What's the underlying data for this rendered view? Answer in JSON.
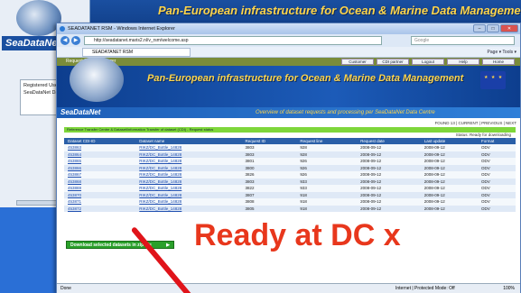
{
  "background_window": {
    "banner_title": "Pan-European infrastructure for Ocean & Marine Data Management",
    "logo_text": "SeaDataNet",
    "box_text": "Registered Users ca SeaDataNet Data Ce"
  },
  "ie": {
    "title": "SEADATANET RSM - Windows Internet Explorer",
    "url": "http://seadatanet.maris2.nl/v_rsm/welcome.asp",
    "search_placeholder": "Google",
    "tab_label": "SEADATANET RSM",
    "tools": "Page ▾  Tools ▾",
    "controls": {
      "min": "–",
      "max": "□",
      "close": "✕"
    }
  },
  "page": {
    "menu_left": "Request Status Manager",
    "menu_buttons": [
      "Customer",
      "CDI partner",
      "Logout",
      "Help",
      "Home"
    ],
    "banner_title": "Pan-European infrastructure for Ocean & Marine Data Management",
    "logo_text": "SeaDataNet",
    "overview": "Overview of dataset requests and processing per SeaDataNet Data Centre",
    "pager": "FOUND 13 | CURRENT | PREVIOUS | NEXT",
    "info_bar": "Reference Transfer Centre & Dataset/information   Transfer of dataset (CDI) - Request status",
    "status_line": "Status: Ready for downloading",
    "table": {
      "headers": [
        "Dataset CDI-ID",
        "Dataset name",
        "Request ID",
        "Request line",
        "Request date",
        "Last update",
        "Format"
      ],
      "rows": [
        [
          "453863",
          "RIKZ/DC_Bottle_14828",
          "3803",
          "928",
          "2008-09-12",
          "2008-09-12",
          "ODV"
        ],
        [
          "453864",
          "RIKZ/DC_Bottle_14828",
          "3803",
          "928",
          "2008-09-12",
          "2008-09-12",
          "ODV"
        ],
        [
          "453865",
          "RIKZ/DC_Bottle_14828",
          "3801",
          "926",
          "2008-09-12",
          "2008-09-12",
          "ODV"
        ],
        [
          "453866",
          "RIKZ/DC_Bottle_14828",
          "3800",
          "926",
          "2008-09-12",
          "2008-09-12",
          "ODV"
        ],
        [
          "453867",
          "RIKZ/DC_Bottle_14828",
          "3826",
          "926",
          "2008-09-12",
          "2008-09-12",
          "ODV"
        ],
        [
          "453868",
          "RIKZ/DC_Bottle_14828",
          "3803",
          "933",
          "2008-09-12",
          "2008-09-12",
          "ODV"
        ],
        [
          "453869",
          "RIKZ/DC_Bottle_14828",
          "3822",
          "933",
          "2008-09-12",
          "2008-09-12",
          "ODV"
        ],
        [
          "453870",
          "RIKZ/DC_Bottle_14828",
          "3807",
          "918",
          "2008-09-12",
          "2008-09-12",
          "ODV"
        ],
        [
          "453871",
          "RIKZ/DC_Bottle_14828",
          "3808",
          "918",
          "2008-09-12",
          "2008-09-12",
          "ODV"
        ],
        [
          "453872",
          "RIKZ/DC_Bottle_14828",
          "3805",
          "918",
          "2008-09-12",
          "2008-09-12",
          "ODV"
        ]
      ]
    },
    "download_label": "Download selected datasets in zip file"
  },
  "overlay": {
    "ready_text": "Ready at DC x"
  },
  "statusbar": {
    "done": "Done",
    "zone": "Internet | Protected Mode: Off",
    "zoom": "100%"
  }
}
